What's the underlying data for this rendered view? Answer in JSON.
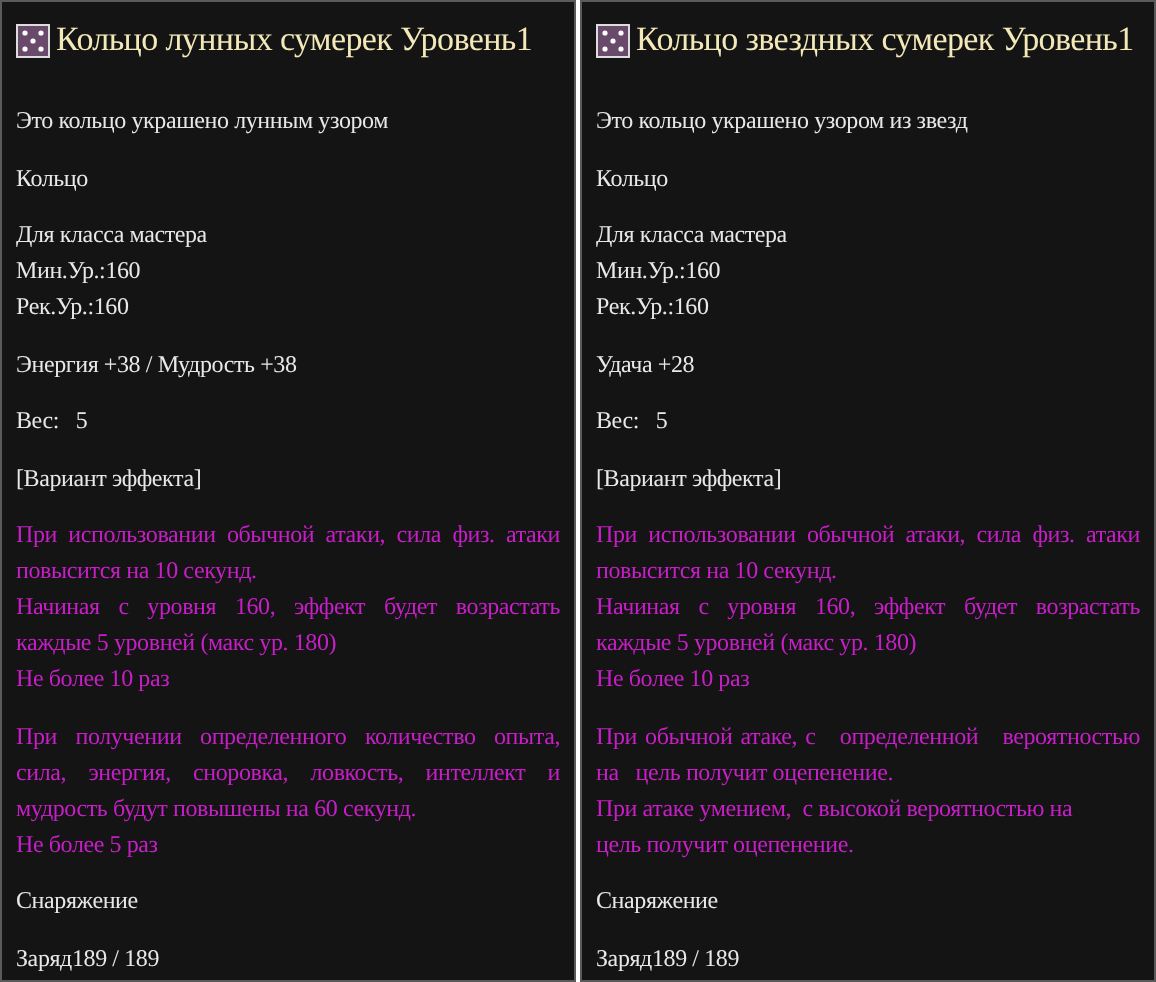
{
  "panels": [
    {
      "title": "Кольцо лунных сумерек Уровень1",
      "sections": [
        {
          "kind": "plain",
          "lines": [
            "Это кольцо украшено лунным узором"
          ]
        },
        {
          "kind": "plain",
          "lines": [
            "Кольцо"
          ]
        },
        {
          "kind": "plain",
          "lines": [
            "Для класса мастера",
            "Мин.Ур.:160",
            "Рек.Ур.:160"
          ]
        },
        {
          "kind": "plain",
          "lines": [
            "Энергия +38 / Мудрость +38"
          ]
        },
        {
          "kind": "plain",
          "lines": [
            "Вес:   5"
          ]
        },
        {
          "kind": "plain",
          "lines": [
            "[Вариант эффекта]"
          ]
        },
        {
          "kind": "effect",
          "lines": [
            "При использовании обычной атаки, сила физ. атаки повысится на 10 секунд.",
            "Начиная с уровня 160, эффект будет возрастать каждые 5 уровней (макс ур. 180)",
            "Не более 10 раз"
          ]
        },
        {
          "kind": "effect",
          "lines": [
            "При получении определенного количество опыта, сила, энергия, сноровка, ловкость, интеллект и мудрость будут повышены на 60 секунд.",
            "Не более 5 раз"
          ]
        },
        {
          "kind": "plain",
          "lines": [
            "Снаряжение"
          ]
        },
        {
          "kind": "plain",
          "lines": [
            "Заряд189 / 189"
          ]
        }
      ]
    },
    {
      "title": "Кольцо звездных сумерек Уровень1",
      "sections": [
        {
          "kind": "plain",
          "lines": [
            "Это кольцо украшено узором из звезд"
          ]
        },
        {
          "kind": "plain",
          "lines": [
            "Кольцо"
          ]
        },
        {
          "kind": "plain",
          "lines": [
            "Для класса мастера",
            "Мин.Ур.:160",
            "Рек.Ур.:160"
          ]
        },
        {
          "kind": "plain",
          "lines": [
            "Удача +28"
          ]
        },
        {
          "kind": "plain",
          "lines": [
            "Вес:   5"
          ]
        },
        {
          "kind": "plain",
          "lines": [
            "[Вариант эффекта]"
          ]
        },
        {
          "kind": "effect",
          "lines": [
            "При использовании обычной атаки, сила физ. атаки повысится на 10 секунд.",
            "Начиная с уровня 160, эффект будет возрастать каждые 5 уровней (макс ур. 180)",
            "Не более 10 раз"
          ]
        },
        {
          "kind": "effect",
          "lines": [
            "При обычной атаке, с   определенной   вероятностью на   цель получит оцепенение.",
            "При атаке умением,  с высокой вероятностью на",
            "цель получит оцепенение."
          ]
        },
        {
          "kind": "plain",
          "lines": [
            "Снаряжение"
          ]
        },
        {
          "kind": "plain",
          "lines": [
            "Заряд189 / 189"
          ]
        }
      ]
    }
  ]
}
